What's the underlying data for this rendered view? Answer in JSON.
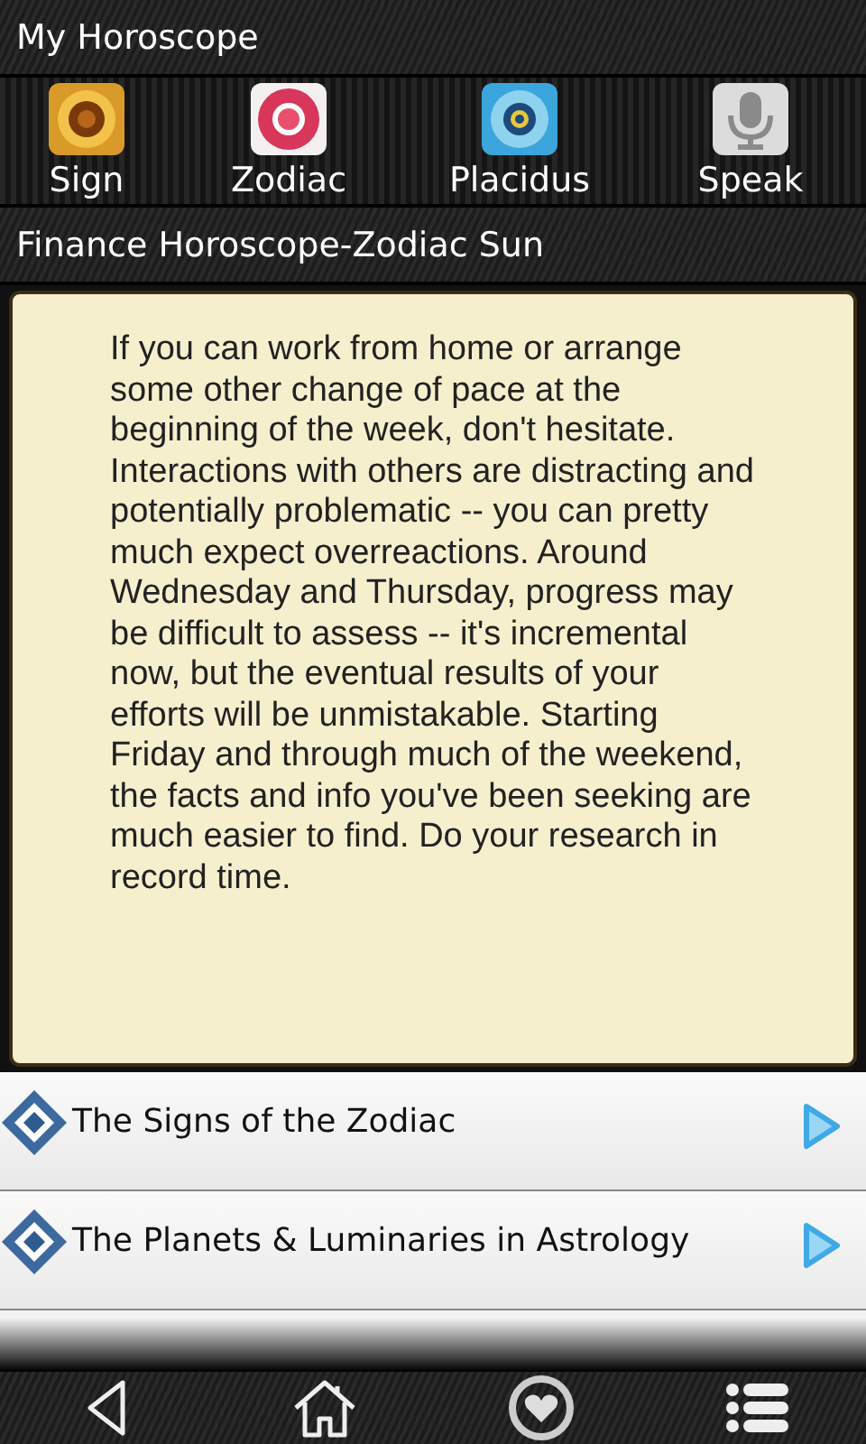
{
  "window": {
    "title": "My Horoscope"
  },
  "toolbar": [
    {
      "label": "Sign",
      "kind": "sign"
    },
    {
      "label": "Zodiac",
      "kind": "zodiac"
    },
    {
      "label": "Placidus",
      "kind": "placidus"
    },
    {
      "label": "Speak",
      "kind": "speak"
    }
  ],
  "section": {
    "title": "Finance Horoscope-Zodiac Sun",
    "body": "If you can work from home or arrange some other change of pace at the beginning of the week, don't hesitate. Interactions with others are distracting and potentially problematic -- you can pretty much expect overreactions. Around Wednesday and Thursday, progress may be difficult to assess -- it's incremental now, but the eventual results of your efforts will be unmistakable. Starting Friday and through much of the weekend, the facts and info you've been seeking are much easier to find. Do your research in record time."
  },
  "list": [
    {
      "title": "The Signs of the Zodiac"
    },
    {
      "title": "The Planets & Luminaries in Astrology"
    }
  ]
}
